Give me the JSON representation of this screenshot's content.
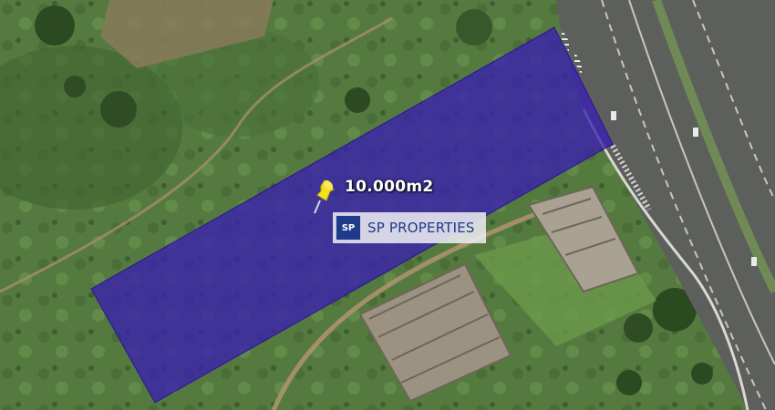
{
  "map": {
    "area_label": "10.000m2",
    "overlay_color": "#3a1fb0",
    "marker_icon": "pushpin-icon",
    "marker_color": "#f2e01a"
  },
  "watermark": {
    "logo_text": "SP",
    "brand_text": "SP PROPERTIES",
    "brand_color": "#1f3a8a"
  }
}
